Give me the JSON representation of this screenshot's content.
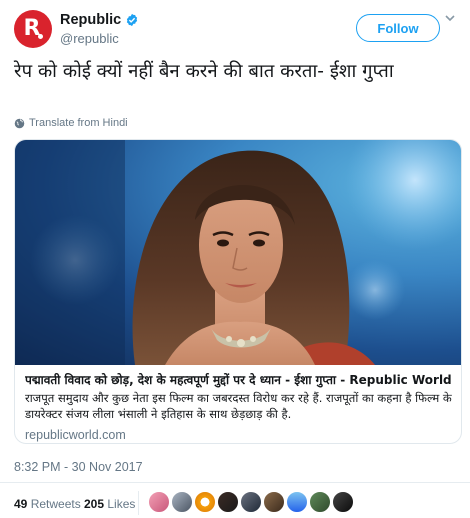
{
  "account": {
    "display_name": "Republic",
    "handle": "@republic",
    "avatar_letter": "R.",
    "follow_label": "Follow",
    "brand_color": "#d9232d",
    "verified_color": "#1da1f2"
  },
  "tweet": {
    "text": "रेप को कोई क्यों नहीं बैन करने की बात करता- ईशा गुप्ता",
    "translate_label": "Translate from Hindi",
    "timestamp": "8:32 PM - 30 Nov 2017"
  },
  "card": {
    "title": "पद्मावती विवाद को छोड़, देश के महत्वपूर्ण मुद्दों पर दे ध्यान - ईशा गुप्ता - Republic World",
    "description": "राजपूत समुदाय और कुछ नेता इस फिल्म का जबरदस्त विरोध कर रहे हैं. राजपूतों का कहना है फिल्म के डायरेक्टर संजय लीला भंसाली ने इतिहास के साथ छेड़छाड़ की है.",
    "domain": "republicworld.com"
  },
  "stats": {
    "retweets_count": "49",
    "retweets_label": "Retweets",
    "likes_count": "205",
    "likes_label": "Likes"
  },
  "likers": [
    "liker-avatar-1",
    "liker-avatar-2",
    "liker-avatar-3",
    "liker-avatar-4",
    "liker-avatar-5",
    "liker-avatar-6",
    "liker-avatar-7",
    "liker-avatar-8",
    "liker-avatar-9"
  ]
}
